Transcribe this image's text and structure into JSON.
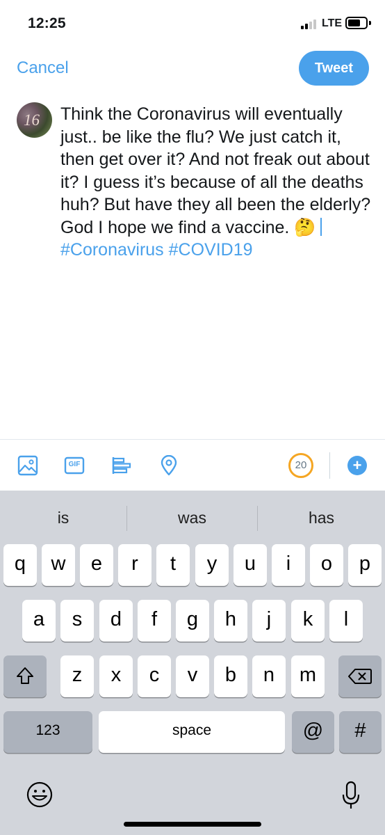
{
  "status_bar": {
    "time": "12:25",
    "network": "LTE",
    "signal_bars": 2,
    "signal_total": 4
  },
  "compose": {
    "cancel_label": "Cancel",
    "tweet_label": "Tweet",
    "avatar_text": "16",
    "text_main": "Think the Coronavirus will eventually just.. be like the flu? We just catch it, then get over it? And not freak out about it? I guess it’s because of all the deaths huh? But have they all been the elderly? God I hope we find a vaccine. ",
    "emoji": "🤔",
    "hashtag_1": "#Coronavirus",
    "hashtag_2": "#COVID19"
  },
  "toolbar": {
    "icons": [
      "image-icon",
      "gif-icon",
      "poll-icon",
      "location-icon"
    ],
    "gif_label": "GIF",
    "char_remaining": "20",
    "add_label": "+"
  },
  "keyboard": {
    "suggestions": [
      "is",
      "was",
      "has"
    ],
    "row1": [
      "q",
      "w",
      "e",
      "r",
      "t",
      "y",
      "u",
      "i",
      "o",
      "p"
    ],
    "row2": [
      "a",
      "s",
      "d",
      "f",
      "g",
      "h",
      "j",
      "k",
      "l"
    ],
    "row3": [
      "z",
      "x",
      "c",
      "v",
      "b",
      "n",
      "m"
    ],
    "numbers_label": "123",
    "space_label": "space",
    "at_label": "@",
    "hash_label": "#"
  },
  "colors": {
    "accent": "#4aa1eb",
    "counter_ring": "#f5a623",
    "keyboard_bg": "#d2d5db"
  }
}
